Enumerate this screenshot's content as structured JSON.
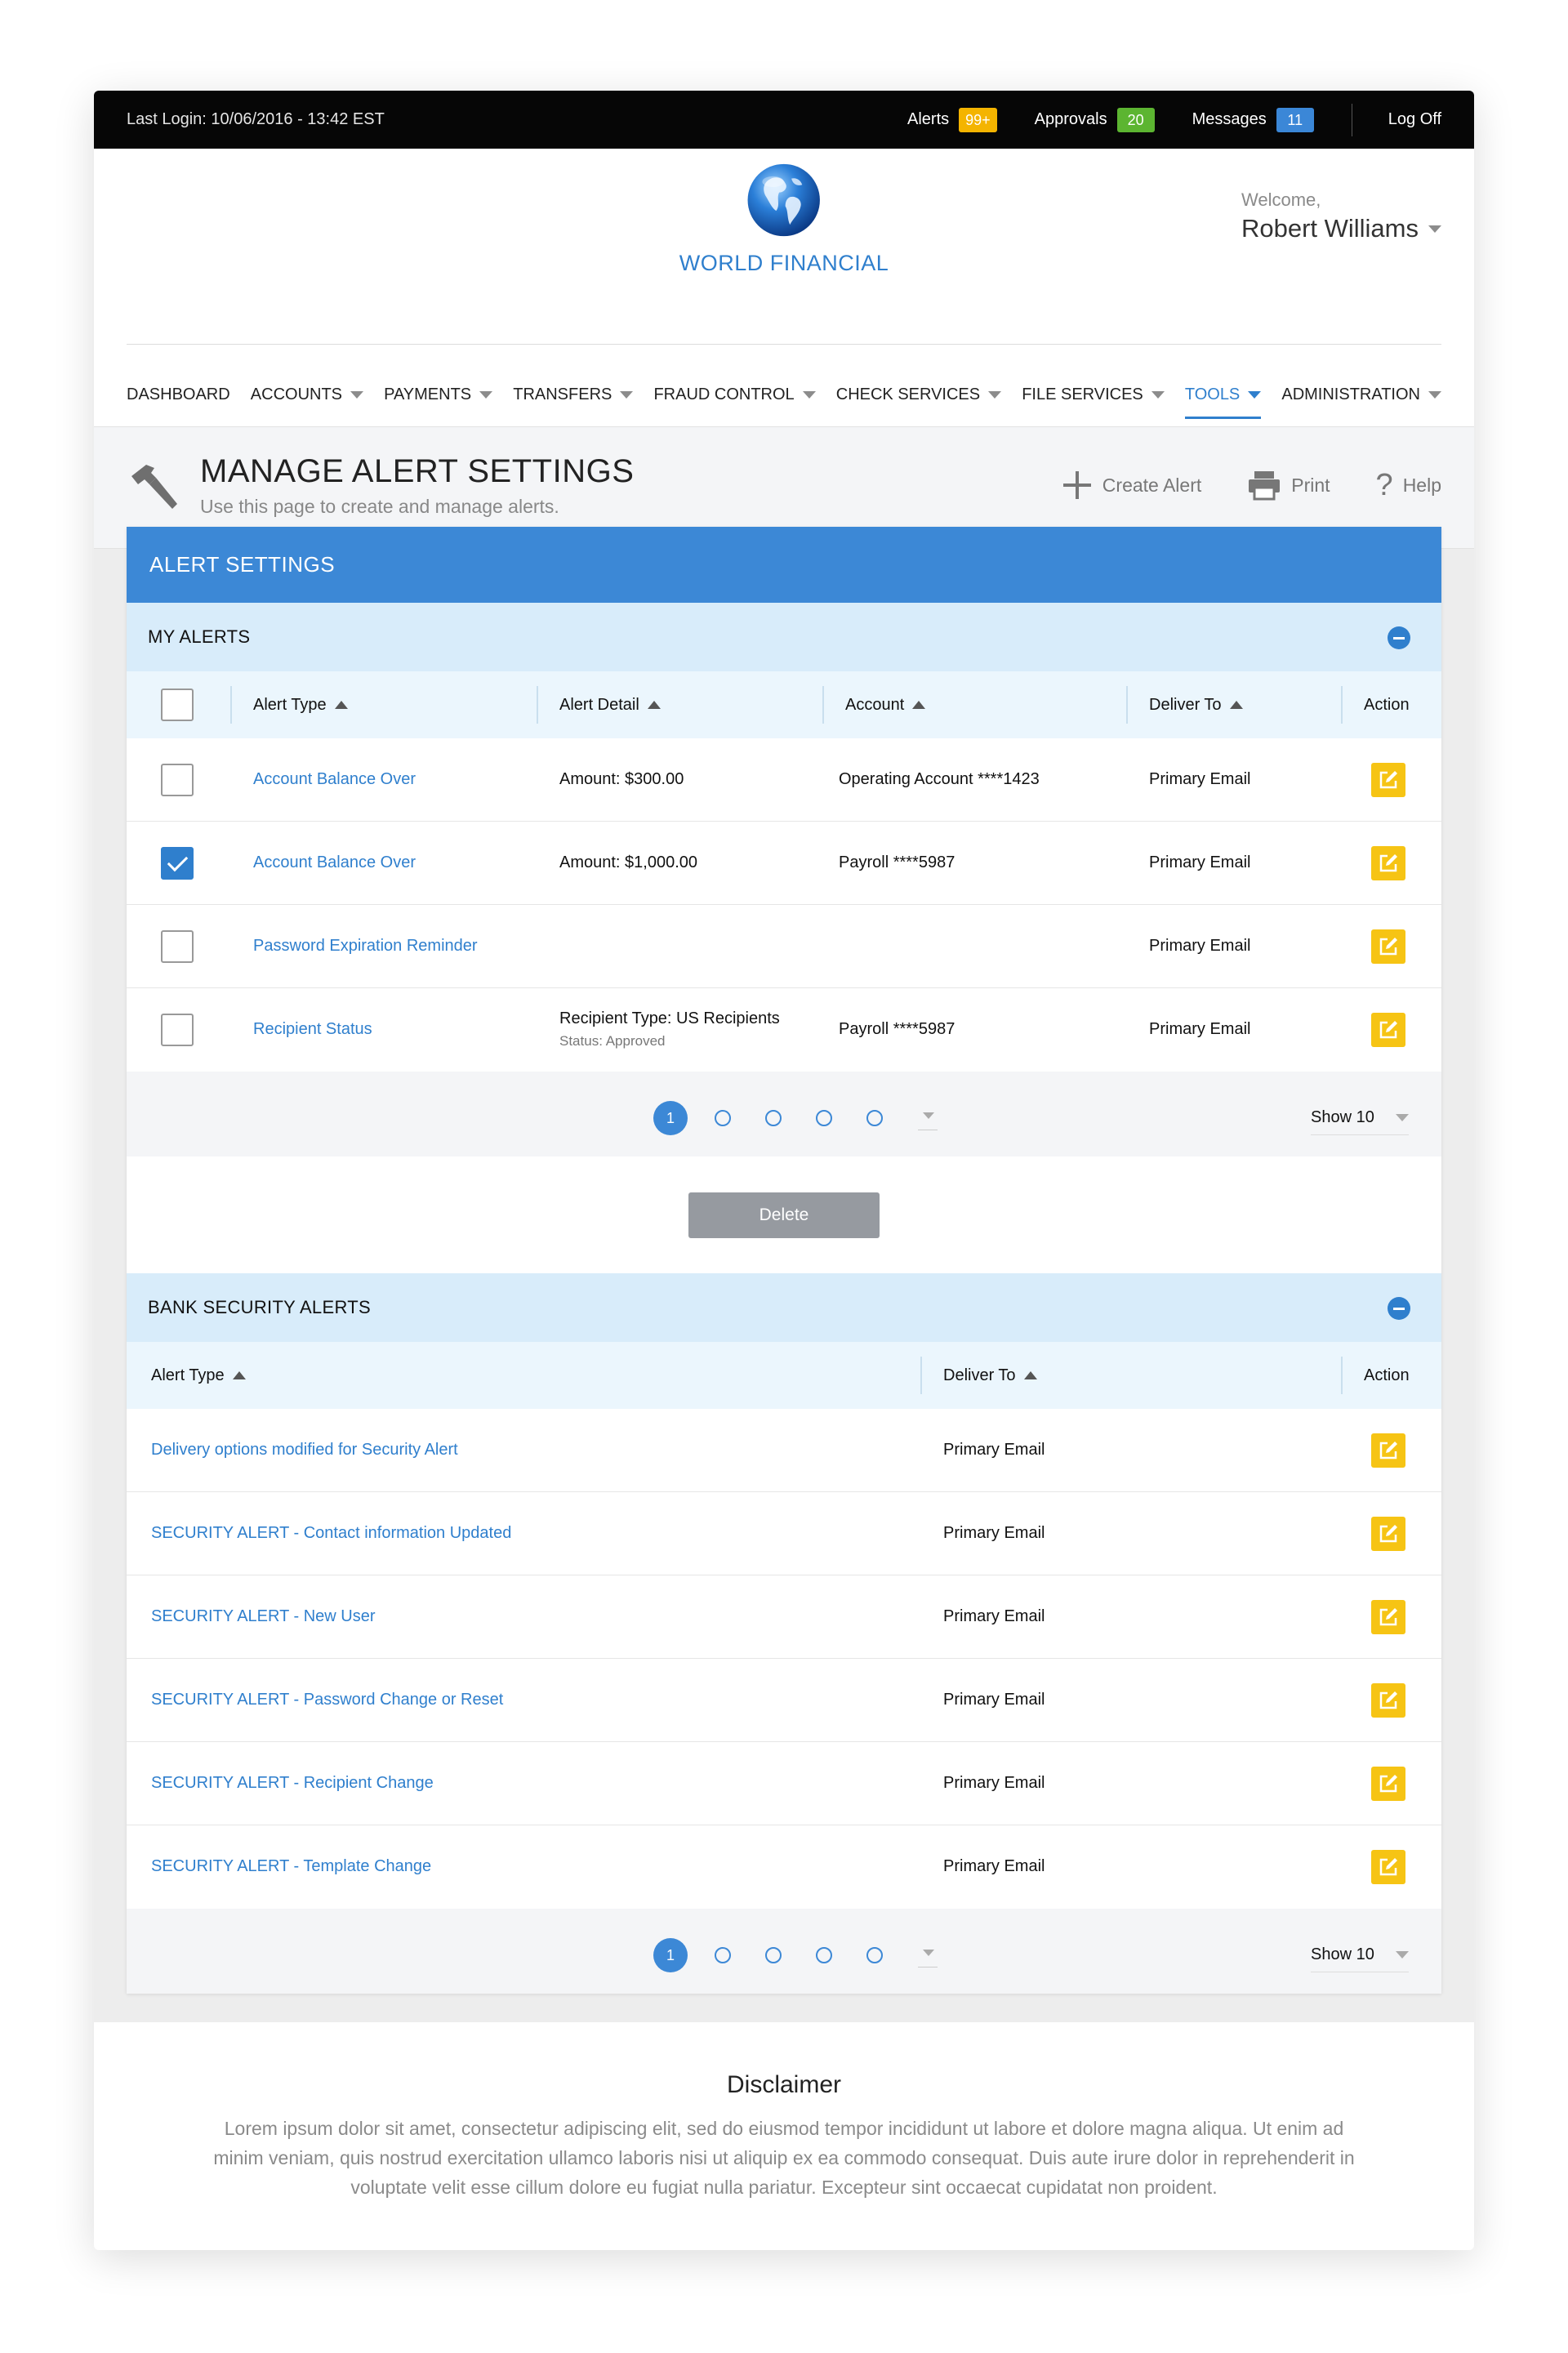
{
  "topbar": {
    "last_login": "Last Login: 10/06/2016 - 13:42 EST",
    "alerts_label": "Alerts",
    "alerts_count": "99+",
    "approvals_label": "Approvals",
    "approvals_count": "20",
    "messages_label": "Messages",
    "messages_count": "11",
    "logoff": "Log Off"
  },
  "header": {
    "logo_text": "WORLD FINANCIAL",
    "welcome": "Welcome,",
    "user_name": "Robert Williams"
  },
  "nav": [
    {
      "label": "DASHBOARD",
      "dropdown": false
    },
    {
      "label": "ACCOUNTS",
      "dropdown": true
    },
    {
      "label": "PAYMENTS",
      "dropdown": true
    },
    {
      "label": "TRANSFERS",
      "dropdown": true
    },
    {
      "label": "FRAUD CONTROL",
      "dropdown": true
    },
    {
      "label": "CHECK SERVICES",
      "dropdown": true
    },
    {
      "label": "FILE SERVICES",
      "dropdown": true
    },
    {
      "label": "TOOLS",
      "dropdown": true,
      "active": true
    },
    {
      "label": "ADMINISTRATION",
      "dropdown": true
    }
  ],
  "page": {
    "title": "MANAGE ALERT SETTINGS",
    "subtitle": "Use this page to create and manage alerts.",
    "create_alert": "Create Alert",
    "print": "Print",
    "help": "Help"
  },
  "panel": {
    "title": "ALERT SETTINGS"
  },
  "my_alerts": {
    "title": "MY ALERTS",
    "columns": {
      "alert_type": "Alert Type",
      "alert_detail": "Alert Detail",
      "account": "Account",
      "deliver_to": "Deliver To",
      "action": "Action"
    },
    "rows": [
      {
        "checked": false,
        "type": "Account Balance Over",
        "detail": "Amount: $300.00",
        "detail_sub": "",
        "account": "Operating  Account ****1423",
        "deliver": "Primary Email"
      },
      {
        "checked": true,
        "type": "Account Balance Over",
        "detail": "Amount: $1,000.00",
        "detail_sub": "",
        "account": "Payroll ****5987",
        "deliver": "Primary Email"
      },
      {
        "checked": false,
        "type": "Password Expiration Reminder",
        "detail": "",
        "detail_sub": "",
        "account": "",
        "deliver": "Primary Email"
      },
      {
        "checked": false,
        "type": "Recipient Status",
        "detail": "Recipient Type: US Recipients",
        "detail_sub": "Status: Approved",
        "account": "Payroll ****5987",
        "deliver": "Primary Email"
      }
    ],
    "pager": {
      "current": "1",
      "show": "Show 10"
    },
    "delete_label": "Delete"
  },
  "bank_alerts": {
    "title": "BANK SECURITY ALERTS",
    "columns": {
      "alert_type": "Alert Type",
      "deliver_to": "Deliver To",
      "action": "Action"
    },
    "rows": [
      {
        "type": "Delivery options modified for Security Alert",
        "deliver": "Primary Email"
      },
      {
        "type": "SECURITY ALERT - Contact information Updated",
        "deliver": "Primary Email"
      },
      {
        "type": "SECURITY ALERT - New User",
        "deliver": "Primary Email"
      },
      {
        "type": "SECURITY ALERT - Password Change or Reset",
        "deliver": "Primary Email"
      },
      {
        "type": "SECURITY ALERT - Recipient Change",
        "deliver": "Primary Email"
      },
      {
        "type": "SECURITY ALERT - Template Change",
        "deliver": "Primary Email"
      }
    ],
    "pager": {
      "current": "1",
      "show": "Show 10"
    }
  },
  "disclaimer": {
    "title": "Disclaimer",
    "text": "Lorem ipsum dolor sit amet, consectetur adipiscing elit, sed do eiusmod tempor incididunt ut labore et dolore magna aliqua. Ut enim ad minim veniam, quis nostrud exercitation ullamco laboris nisi ut aliquip ex ea commodo consequat. Duis aute irure dolor in reprehenderit in voluptate velit esse cillum dolore eu fugiat nulla pariatur. Excepteur sint occaecat cupidatat non proident."
  },
  "colors": {
    "brand": "#3c88d6",
    "action": "#f6c414",
    "alerts_badge": "#f4b400",
    "approvals_badge": "#5cb531",
    "messages_badge": "#3b87d7"
  }
}
